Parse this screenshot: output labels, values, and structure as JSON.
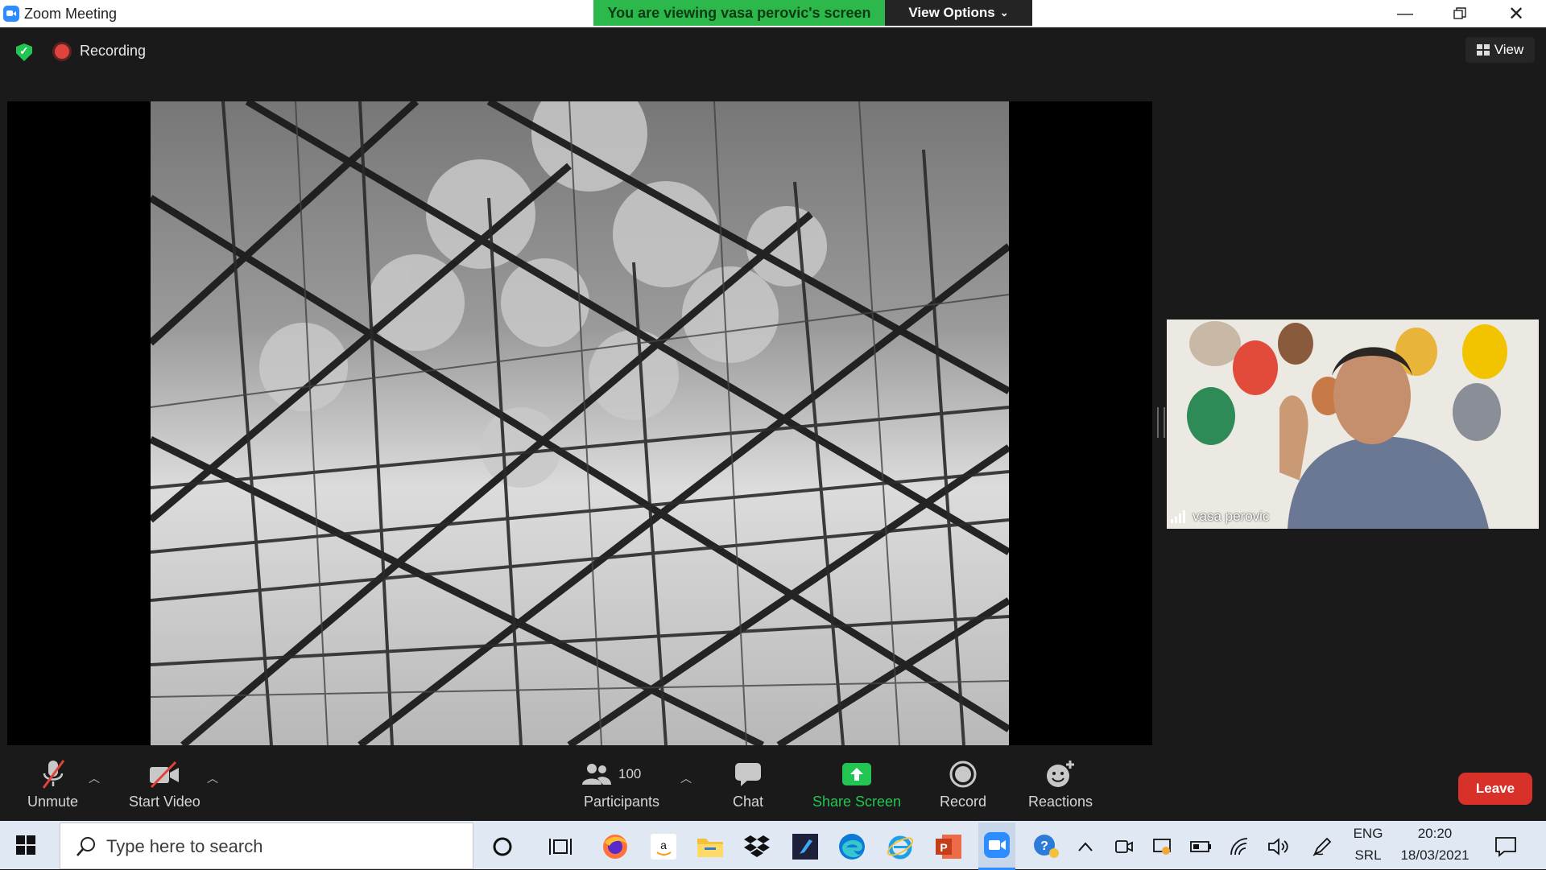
{
  "window": {
    "title": "Zoom Meeting"
  },
  "banner": {
    "viewing_text": "You are viewing vasa perovic's screen",
    "view_options_label": "View Options"
  },
  "meeting": {
    "recording_label": "Recording",
    "view_label": "View"
  },
  "speaker": {
    "name": "vasa perovic"
  },
  "toolbar": {
    "unmute_label": "Unmute",
    "start_video_label": "Start Video",
    "participants_label": "Participants",
    "participants_count": "100",
    "chat_label": "Chat",
    "share_screen_label": "Share Screen",
    "record_label": "Record",
    "reactions_label": "Reactions",
    "leave_label": "Leave"
  },
  "taskbar": {
    "search_placeholder": "Type here to search",
    "language_top": "ENG",
    "language_bottom": "SRL",
    "time": "20:20",
    "date": "18/03/2021",
    "icons": [
      "cortana-icon",
      "task-view-icon",
      "firefox-icon",
      "amazon-icon",
      "file-explorer-icon",
      "dropbox-icon",
      "visual-studio-icon",
      "edge-icon",
      "internet-explorer-icon",
      "powerpoint-icon",
      "zoom-icon"
    ]
  },
  "colors": {
    "banner_green": "#2DB84C",
    "zoom_blue": "#2D8CFF",
    "leave_red": "#D7312A",
    "share_green": "#23C552"
  }
}
